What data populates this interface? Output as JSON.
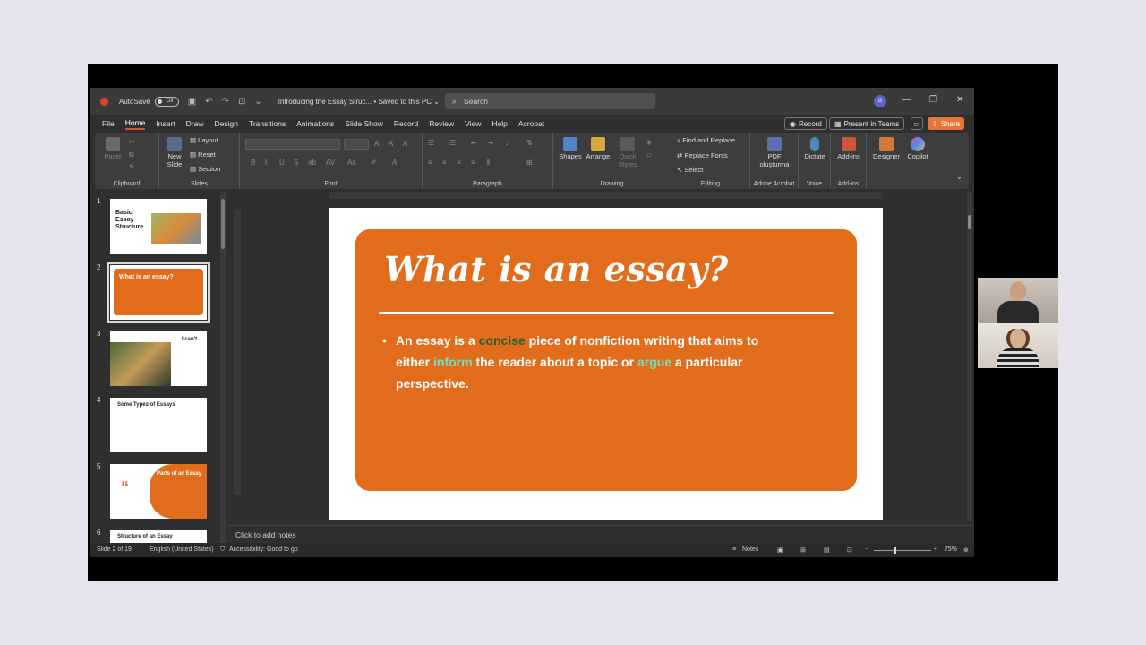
{
  "titlebar": {
    "autosave_label": "AutoSave",
    "autosave_state": "Off",
    "doc_title": "Introducing the Essay Struc... • Saved to this PC ⌄",
    "search_placeholder": "Search",
    "avatar_initial": "G"
  },
  "menu": {
    "tabs": [
      "File",
      "Home",
      "Insert",
      "Draw",
      "Design",
      "Transitions",
      "Animations",
      "Slide Show",
      "Record",
      "Review",
      "View",
      "Help",
      "Acrobat"
    ],
    "active": "Home",
    "record_label": "Record",
    "teams_label": "Present in Teams",
    "share_label": "Share"
  },
  "ribbon": {
    "clipboard": {
      "label": "Clipboard",
      "paste": "Paste"
    },
    "slides": {
      "label": "Slides",
      "new_slide": "New Slide",
      "layout": "Layout",
      "reset": "Reset",
      "section": "Section"
    },
    "font": {
      "label": "Font"
    },
    "paragraph": {
      "label": "Paragraph"
    },
    "drawing": {
      "label": "Drawing",
      "shapes": "Shapes",
      "arrange": "Arrange",
      "quick_styles": "Quick Styles"
    },
    "editing": {
      "label": "Editing",
      "find_replace": "Find and Replace",
      "replace_fonts": "Replace Fonts",
      "select": "Select"
    },
    "acrobat": {
      "label": "Adobe Acrobat",
      "pdf": "PDF oluşturma"
    },
    "voice": {
      "label": "Voice",
      "dictate": "Dictate"
    },
    "addins": {
      "label": "Add-ins",
      "addins": "Add-ins"
    },
    "designer": "Designer",
    "copilot": "Copilot"
  },
  "thumbnails": [
    {
      "num": "1",
      "title": "Basic Essay Structure"
    },
    {
      "num": "2",
      "title": "What is an essay?"
    },
    {
      "num": "3",
      "title": "I can't"
    },
    {
      "num": "4",
      "title": "Some Types of Essays"
    },
    {
      "num": "5",
      "title": "Parts of an Essay"
    },
    {
      "num": "6",
      "title": "Structure of an Essay"
    }
  ],
  "slide": {
    "title": "What is an essay?",
    "line1_a": "An essay is a ",
    "line1_kw": "concise",
    "line1_b": " piece of nonfiction writing that aims to",
    "line2_a": "either ",
    "line2_kw1": "inform",
    "line2_b": " the reader about a topic or ",
    "line2_kw2": "argue",
    "line2_c": " a particular",
    "line3": "perspective."
  },
  "notes_placeholder": "Click to add notes",
  "status": {
    "slide_info": "Slide 2 of 19",
    "language": "English (United States)",
    "accessibility": "Accessibility: Good to go",
    "notes": "Notes",
    "zoom": "75%"
  },
  "colors": {
    "accent": "#e16d1c",
    "share": "#e6753c",
    "concise": "#24622e",
    "teal": "#6fe1c0"
  }
}
